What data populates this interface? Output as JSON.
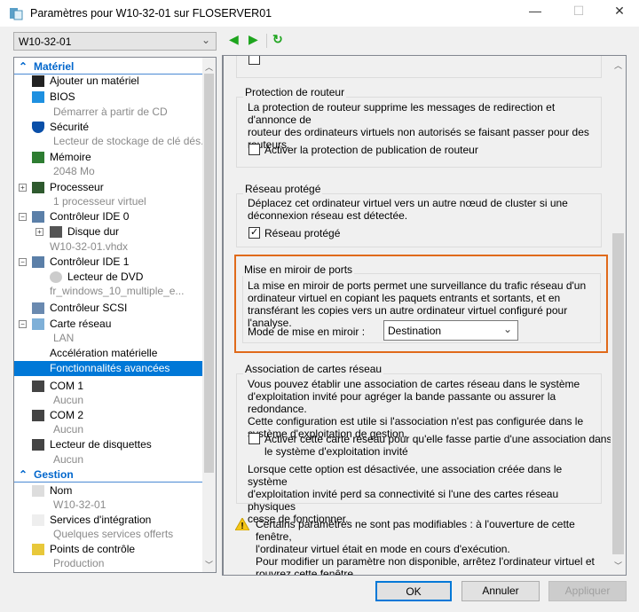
{
  "window": {
    "title": "Paramètres pour W10-32-01 sur FLOSERVER01",
    "minimize": "—",
    "maximize": "☐",
    "close": "✕"
  },
  "toolbar": {
    "vm_selected": "W10-32-01",
    "back": "◀",
    "forward": "▶",
    "refresh": "↻"
  },
  "tree": [
    {
      "label": "Matériel",
      "kind": "hdr",
      "icon": "collapse-icon"
    },
    {
      "label": "Ajouter un matériel",
      "indent": 1,
      "icon": "add-hardware-icon"
    },
    {
      "label": "BIOS",
      "indent": 1,
      "icon": "bios-icon"
    },
    {
      "label": "Démarrer à partir de CD",
      "kind": "sub",
      "indent": 1
    },
    {
      "label": "Sécurité",
      "indent": 1,
      "icon": "shield-icon"
    },
    {
      "label": "Lecteur de stockage de clé dés...",
      "kind": "sub",
      "indent": 1
    },
    {
      "label": "Mémoire",
      "indent": 1,
      "icon": "memory-icon"
    },
    {
      "label": "2048 Mo",
      "kind": "sub",
      "indent": 1
    },
    {
      "label": "Processeur",
      "indent": 1,
      "icon": "processor-icon",
      "pm": "+"
    },
    {
      "label": "1 processeur virtuel",
      "kind": "sub",
      "indent": 1
    },
    {
      "label": "Contrôleur IDE 0",
      "indent": 1,
      "icon": "ide-controller-icon",
      "pm": "−"
    },
    {
      "label": "Disque dur",
      "indent": 2,
      "icon": "hard-disk-icon",
      "pm": "+"
    },
    {
      "label": "W10-32-01.vhdx",
      "kind": "sub",
      "indent": 2
    },
    {
      "label": "Contrôleur IDE 1",
      "indent": 1,
      "icon": "ide-controller-icon",
      "pm": "−"
    },
    {
      "label": "Lecteur de DVD",
      "indent": 2,
      "icon": "dvd-icon"
    },
    {
      "label": "fr_windows_10_multiple_e...",
      "kind": "sub",
      "indent": 2
    },
    {
      "label": "Contrôleur SCSI",
      "indent": 1,
      "icon": "scsi-icon"
    },
    {
      "label": "Carte réseau",
      "indent": 1,
      "icon": "network-adapter-icon",
      "pm": "−"
    },
    {
      "label": "LAN",
      "kind": "sub",
      "indent": 1
    },
    {
      "label": "Accélération matérielle",
      "indent": 2
    },
    {
      "label": "Fonctionnalités avancées",
      "kind": "sel",
      "indent": 2
    },
    {
      "label": "COM 1",
      "indent": 1,
      "icon": "com-port-icon"
    },
    {
      "label": "Aucun",
      "kind": "sub",
      "indent": 1
    },
    {
      "label": "COM 2",
      "indent": 1,
      "icon": "com-port-icon"
    },
    {
      "label": "Aucun",
      "kind": "sub",
      "indent": 1
    },
    {
      "label": "Lecteur de disquettes",
      "indent": 1,
      "icon": "floppy-icon"
    },
    {
      "label": "Aucun",
      "kind": "sub",
      "indent": 1
    },
    {
      "label": "Gestion",
      "kind": "hdr",
      "icon": "collapse-icon"
    },
    {
      "label": "Nom",
      "indent": 1,
      "icon": "name-icon"
    },
    {
      "label": "W10-32-01",
      "kind": "sub",
      "indent": 1
    },
    {
      "label": "Services d'intégration",
      "indent": 1,
      "icon": "integration-services-icon"
    },
    {
      "label": "Quelques services offerts",
      "kind": "sub",
      "indent": 1
    },
    {
      "label": "Points de contrôle",
      "indent": 1,
      "icon": "checkpoint-icon"
    },
    {
      "label": "Production",
      "kind": "sub",
      "indent": 1
    }
  ],
  "router": {
    "title": "Protection de routeur",
    "lines": [
      "La protection de routeur supprime les messages de redirection et d'annonce de",
      "routeur des ordinateurs virtuels non autorisés se faisant passer pour des",
      "routeurs."
    ],
    "checkbox": "Activer la protection de publication de routeur",
    "checked": false
  },
  "protected": {
    "title": "Réseau protégé",
    "lines": [
      "Déplacez cet ordinateur virtuel vers un autre nœud de cluster si une",
      "déconnexion réseau est détectée."
    ],
    "checkbox": "Réseau protégé",
    "checked": true
  },
  "mirror": {
    "title": "Mise en miroir de ports",
    "lines": [
      "La mise en miroir de ports permet une surveillance du trafic réseau d'un",
      "ordinateur virtuel en copiant les paquets entrants et sortants, et en",
      "transférant les copies vers un autre ordinateur virtuel configuré pour l'analyse."
    ],
    "mode_label": "Mode de mise en miroir :",
    "mode_value": "Destination",
    "highlight": "#e06a1a"
  },
  "teaming": {
    "title": "Association de cartes réseau",
    "lines": [
      "Vous pouvez établir une association de cartes réseau dans le système",
      "d'exploitation invité pour agréger la bande passante ou assurer la redondance.",
      "Cette configuration est utile si l'association n'est pas configurée dans le",
      "système d'exploitation de gestion."
    ],
    "checkbox_lines": [
      "Activer cette carte réseau pour qu'elle fasse partie d'une association dans",
      "le système d'exploitation invité"
    ],
    "checked": false,
    "note_lines": [
      "Lorsque cette option est désactivée, une association créée dans le système",
      "d'exploitation invité perd sa connectivité si l'une des cartes réseau physiques",
      "cesse de fonctionner."
    ]
  },
  "warning": {
    "lines": [
      "Certains paramètres ne sont pas modifiables : à l'ouverture de cette fenêtre,",
      "l'ordinateur virtuel était en mode en cours d'exécution.",
      "Pour modifier un paramètre non disponible, arrêtez l'ordinateur virtuel et",
      "rouvrez cette fenêtre."
    ]
  },
  "buttons": {
    "ok": "OK",
    "cancel": "Annuler",
    "apply": "Appliquer"
  }
}
